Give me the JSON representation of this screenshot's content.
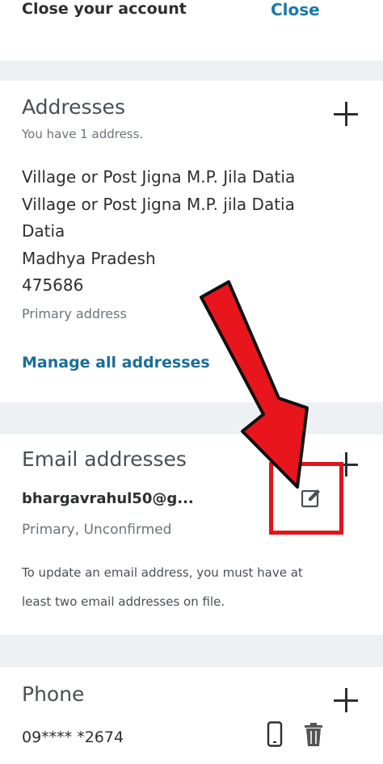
{
  "close_account": {
    "label": "Close your account",
    "action": "Close"
  },
  "addresses": {
    "title": "Addresses",
    "count_text": "You have 1 address.",
    "lines": [
      "Village or Post Jigna M.P. Jila Datia",
      "Village or Post Jigna M.P. jila Datia",
      "Datia",
      "Madhya Pradesh",
      "475686"
    ],
    "primary_label": "Primary address",
    "manage_link": "Manage all addresses"
  },
  "email_addresses": {
    "title": "Email addresses",
    "email": "bhargavrahul50@g...",
    "status": "Primary, Unconfirmed",
    "note_line1": "To update an email address, you must have at",
    "note_line2": "least two email addresses on file."
  },
  "phone": {
    "title": "Phone",
    "number": "09**** *2674"
  },
  "colors": {
    "link": "#1a7aa6",
    "annotation": "#e1141b"
  },
  "icons": [
    "plus-icon",
    "edit-icon",
    "mobile-phone-icon",
    "trash-icon",
    "red-arrow-annotation"
  ]
}
